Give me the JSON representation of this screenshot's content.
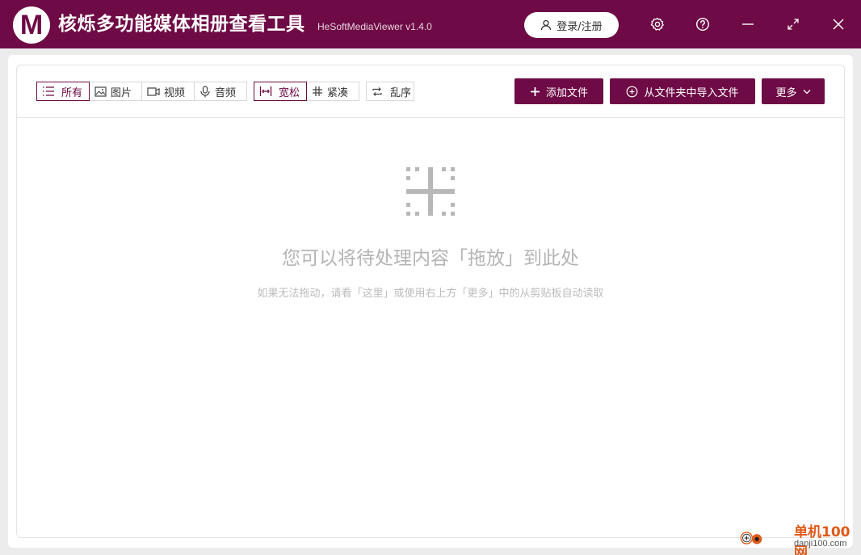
{
  "app": {
    "logo_letter": "M",
    "title": "核烁多功能媒体相册查看工具",
    "subtitle": "HeSoftMediaViewer v1.4.0",
    "login_label": "登录/注册",
    "accent_color": "#6e0a45"
  },
  "window_controls": {
    "settings_icon": "gear-icon",
    "help_icon": "question-icon",
    "minimize_icon": "minimize-icon",
    "maximize_icon": "expand-icon",
    "close_icon": "close-icon"
  },
  "toolbar": {
    "filters": [
      {
        "label": "所有",
        "icon": "list-icon",
        "active": true
      },
      {
        "label": "图片",
        "icon": "image-icon",
        "active": false
      },
      {
        "label": "视频",
        "icon": "video-icon",
        "active": false
      },
      {
        "label": "音频",
        "icon": "microphone-icon",
        "active": false
      }
    ],
    "layouts": [
      {
        "label": "宽松",
        "icon": "spacing-icon",
        "active": true
      },
      {
        "label": "紧凑",
        "icon": "grid-icon",
        "active": false
      }
    ],
    "shuffle_label": "乱序",
    "add_file_label": "添加文件",
    "import_folder_label": "从文件夹中导入文件",
    "more_label": "更多"
  },
  "empty_state": {
    "title": "您可以将待处理内容「拖放」到此处",
    "hint": "如果无法拖动，请看「这里」或使用右上方「更多」中的从剪贴板自动读取"
  },
  "watermark": {
    "name": "单机100网",
    "site": "danji100.com"
  }
}
